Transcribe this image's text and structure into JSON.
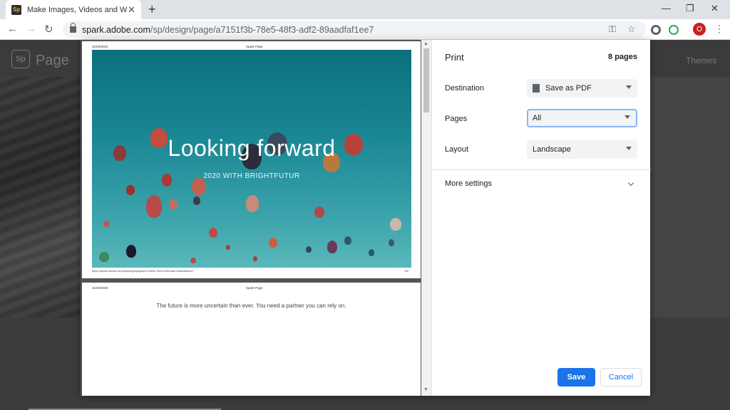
{
  "browser": {
    "tab_title": "Make Images, Videos and Web St",
    "favicon_text": "Sp",
    "url_host": "spark.adobe.com",
    "url_path": "/sp/design/page/a7151f3b-78e5-48f3-adf2-89aadfaf1ee7",
    "avatar_letter": "O"
  },
  "background_page": {
    "logo_text": "Sp",
    "page_label": "Page",
    "themes_label": "Themes"
  },
  "preview": {
    "page1": {
      "date": "31/03/2020",
      "header": "Spark Page",
      "hero_title": "Looking forward",
      "hero_subtitle": "2020 WITH BRIGHTFUTUR",
      "footer_url": "https://spark.adobe.com/sp/design/page/a7151f3b-78e5-48f3-adf2-89aadfaf1ee7",
      "page_num": "1/8"
    },
    "page2": {
      "date": "31/03/2020",
      "header": "Spark Page",
      "body_text": "The future is more uncertain than ever. You need a partner you can rely on."
    }
  },
  "print": {
    "title": "Print",
    "page_count": "8 pages",
    "destination_label": "Destination",
    "destination_value": "Save as PDF",
    "pages_label": "Pages",
    "pages_value": "All",
    "layout_label": "Layout",
    "layout_value": "Landscape",
    "more_settings": "More settings",
    "save_label": "Save",
    "cancel_label": "Cancel"
  }
}
